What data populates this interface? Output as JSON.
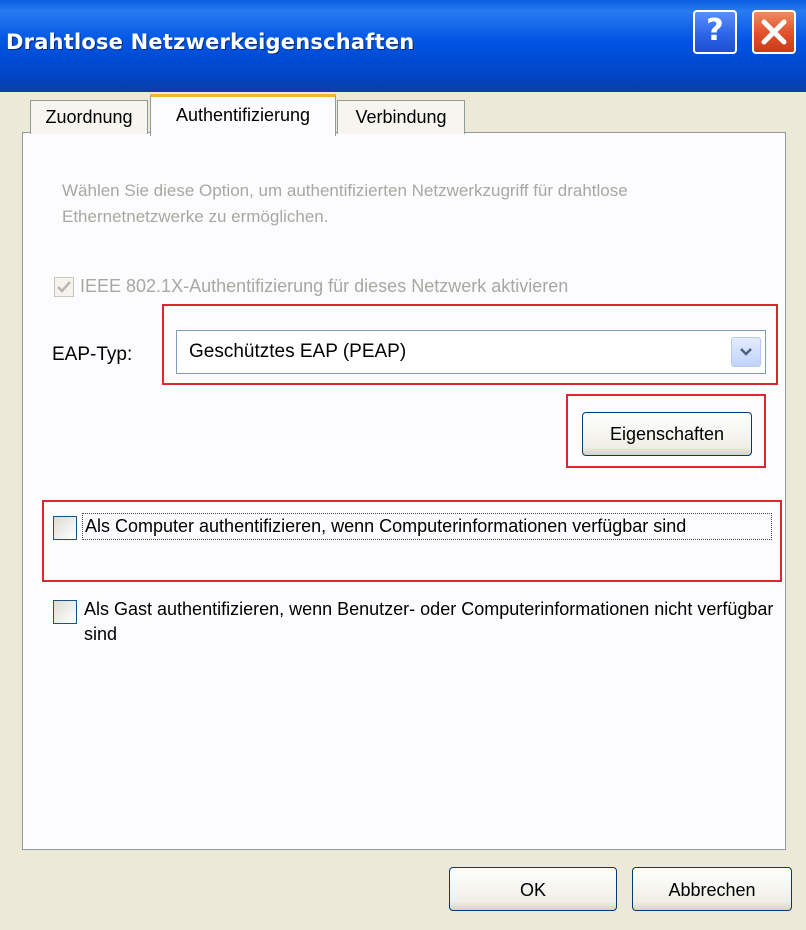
{
  "window": {
    "title": "Drahtlose Netzwerkeigenschaften",
    "help_glyph": "?",
    "close_icon": "close-icon"
  },
  "tabs": [
    {
      "label": "Zuordnung",
      "active": false
    },
    {
      "label": "Authentifizierung",
      "active": true
    },
    {
      "label": "Verbindung",
      "active": false
    }
  ],
  "auth": {
    "description": "Wählen Sie diese Option, um authentifizierten Netzwerkzugriff für drahtlose Ethernetnetzwerke zu ermöglichen.",
    "ieee_label": "IEEE 802.1X-Authentifizierung für dieses Netzwerk aktivieren",
    "ieee_checked": true,
    "ieee_disabled": true,
    "eap_label": "EAP-Typ:",
    "eap_value": "Geschütztes EAP (PEAP)",
    "properties_button": "Eigenschaften",
    "computer_auth_label": "Als Computer authentifizieren, wenn Computerinformationen verfügbar sind",
    "computer_auth_checked": false,
    "guest_auth_label": "Als Gast authentifizieren, wenn Benutzer- oder Computerinformationen nicht verfügbar sind",
    "guest_auth_checked": false
  },
  "footer": {
    "ok_label": "OK",
    "cancel_label": "Abbrechen"
  },
  "colors": {
    "titlebar": "#0054e3",
    "highlight": "#d9282f",
    "disabled_text": "#a8a8a0",
    "active_tab_accent": "#f2b53a"
  }
}
